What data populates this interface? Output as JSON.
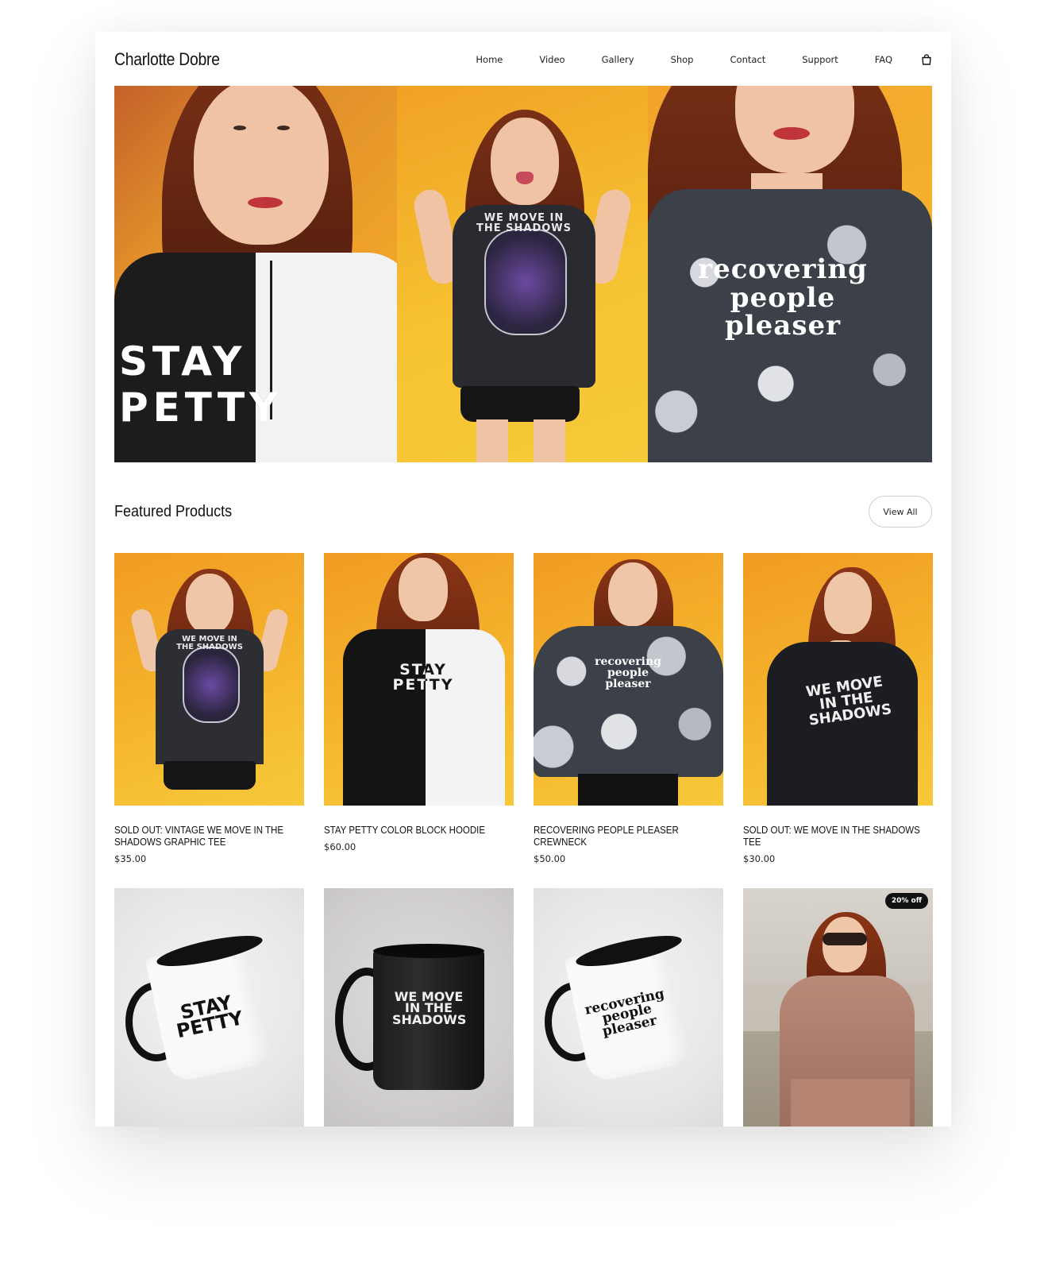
{
  "header": {
    "logo": "Charlotte Dobre",
    "nav": [
      "Home",
      "Video",
      "Gallery",
      "Shop",
      "Contact",
      "Support",
      "FAQ"
    ],
    "cart_icon": "shopping-bag-icon"
  },
  "hero": {
    "panels": [
      {
        "shirt_text": "STAY PETTY"
      },
      {
        "shirt_text": "WE MOVE IN THE SHADOWS"
      },
      {
        "shirt_text": "recovering people pleaser"
      }
    ]
  },
  "featured": {
    "title": "Featured Products",
    "view_all": "View All",
    "products": [
      {
        "title": "SOLD OUT: VINTAGE WE MOVE IN THE SHADOWS GRAPHIC TEE",
        "price": "$35.00",
        "art": "WE MOVE IN THE SHADOWS"
      },
      {
        "title": "STAY PETTY COLOR BLOCK HOODIE",
        "price": "$60.00",
        "art": "STAY PETTY"
      },
      {
        "title": "RECOVERING PEOPLE PLEASER CREWNECK",
        "price": "$50.00",
        "art": "recovering people pleaser"
      },
      {
        "title": "SOLD OUT: WE MOVE IN THE SHADOWS TEE",
        "price": "$30.00",
        "art": "WE MOVE IN THE SHADOWS"
      }
    ],
    "row2": [
      {
        "art": "STAY PETTY"
      },
      {
        "art": "WE MOVE IN THE SHADOWS"
      },
      {
        "art": "recovering people pleaser"
      },
      {
        "badge": "20% off"
      }
    ]
  },
  "colors": {
    "accent_orange": "#f5b52d",
    "text": "#111111",
    "badge_bg": "#111111"
  }
}
